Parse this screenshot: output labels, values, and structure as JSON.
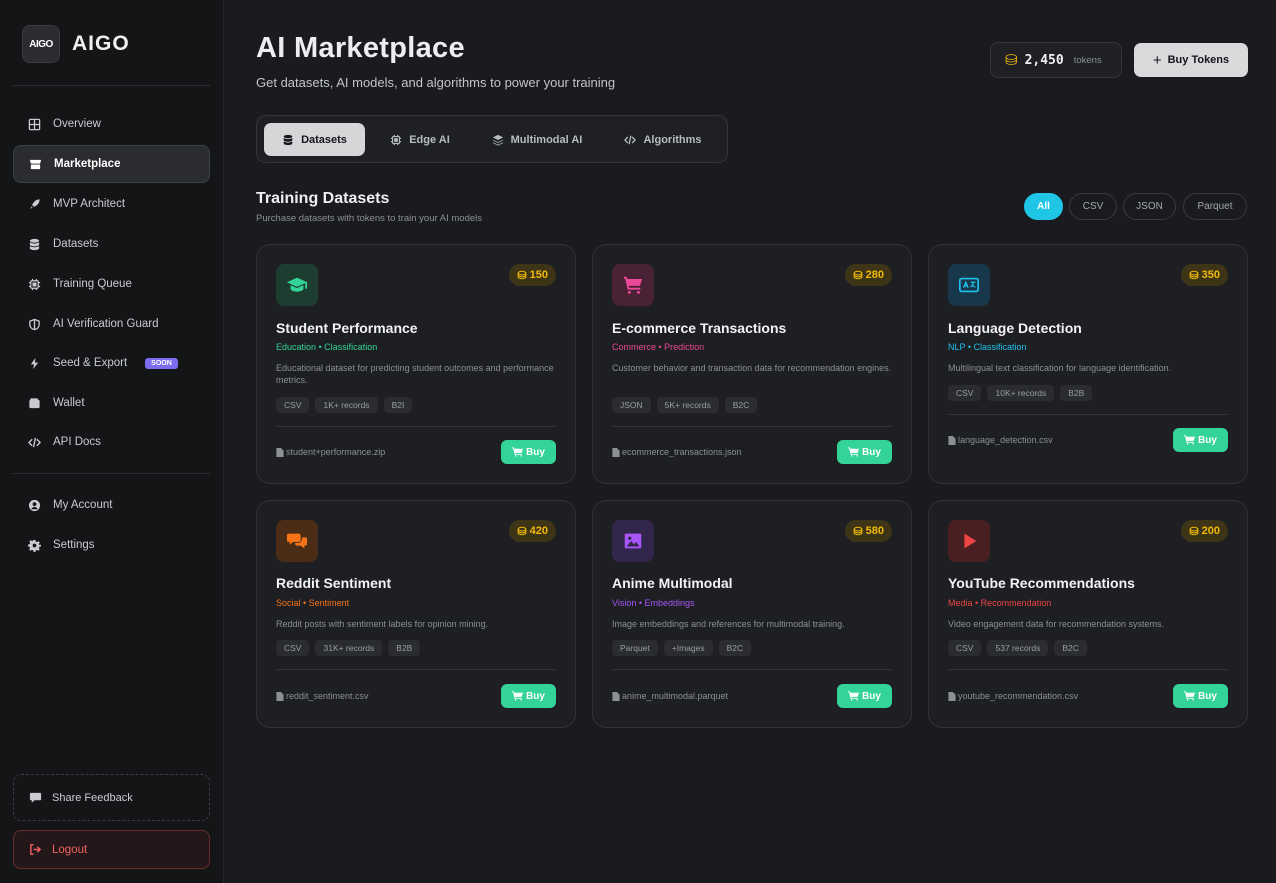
{
  "brand": {
    "name": "AIGO",
    "logo_text": "AIGO"
  },
  "sidebar": {
    "items": [
      {
        "label": "Overview",
        "icon": "grid-icon"
      },
      {
        "label": "Marketplace",
        "icon": "store-icon"
      },
      {
        "label": "MVP Architect",
        "icon": "rocket-icon"
      },
      {
        "label": "Datasets",
        "icon": "database-icon"
      },
      {
        "label": "Training Queue",
        "icon": "chip-icon"
      },
      {
        "label": "AI Verification Guard",
        "icon": "shield-icon"
      },
      {
        "label": "Seed & Export",
        "icon": "lightning-icon",
        "badge": "SOON"
      },
      {
        "label": "Wallet",
        "icon": "wallet-icon"
      },
      {
        "label": "API Docs",
        "icon": "code-icon"
      }
    ],
    "account_items": [
      {
        "label": "My Account",
        "icon": "user-icon"
      },
      {
        "label": "Settings",
        "icon": "gear-icon"
      }
    ],
    "feedback_label": "Share Feedback",
    "logout_label": "Logout"
  },
  "header": {
    "title": "AI Marketplace",
    "subtitle": "Get datasets, AI models, and algorithms to power your training",
    "tokens_value": "2,450",
    "tokens_label": "tokens",
    "buy_tokens_label": "Buy Tokens"
  },
  "tabs": [
    {
      "label": "Datasets",
      "icon": "database-icon",
      "active": true
    },
    {
      "label": "Edge AI",
      "icon": "chip-icon"
    },
    {
      "label": "Multimodal AI",
      "icon": "layers-icon"
    },
    {
      "label": "Algorithms",
      "icon": "code-icon"
    }
  ],
  "section": {
    "title": "Training Datasets",
    "subtitle": "Purchase datasets with tokens to train your AI models",
    "filters": [
      {
        "label": "All",
        "active": true
      },
      {
        "label": "CSV"
      },
      {
        "label": "JSON"
      },
      {
        "label": "Parquet"
      }
    ]
  },
  "cards": [
    {
      "title": "Student Performance",
      "tags": "Education • Classification",
      "tag_color": "#34d399",
      "icon": "graduation-cap-icon",
      "icon_bg": "#1e3d31",
      "icon_color": "#34d399",
      "price": "150",
      "desc": "Educational dataset for predicting student outcomes and performance metrics.",
      "chips": [
        "CSV",
        "1K+ records",
        "B2I"
      ],
      "file": "student+performance.zip",
      "buy": "Buy"
    },
    {
      "title": "E-commerce Transactions",
      "tags": "Commerce • Prediction",
      "tag_color": "#ec4899",
      "icon": "cart-icon",
      "icon_bg": "#4a2236",
      "icon_color": "#ec4899",
      "price": "280",
      "desc": "Customer behavior and transaction data for recommendation engines.",
      "chips": [
        "JSON",
        "5K+ records",
        "B2C"
      ],
      "file": "ecommerce_transactions.json",
      "buy": "Buy"
    },
    {
      "title": "Language Detection",
      "tags": "NLP • Classification",
      "tag_color": "#22c1ee",
      "icon": "translate-icon",
      "icon_bg": "#17384a",
      "icon_color": "#22c1ee",
      "price": "350",
      "desc": "Multilingual text classification for language identification.",
      "chips": [
        "CSV",
        "10K+ records",
        "B2B"
      ],
      "file": "language_detection.csv",
      "buy": "Buy"
    },
    {
      "title": "Reddit Sentiment",
      "tags": "Social • Sentiment",
      "tag_color": "#f97316",
      "icon": "chat-bubbles-icon",
      "icon_bg": "#4a2c17",
      "icon_color": "#f97316",
      "price": "420",
      "desc": "Reddit posts with sentiment labels for opinion mining.",
      "chips": [
        "CSV",
        "31K+ records",
        "B2B"
      ],
      "file": "reddit_sentiment.csv",
      "buy": "Buy"
    },
    {
      "title": "Anime Multimodal",
      "tags": "Vision • Embeddings",
      "tag_color": "#a855f7",
      "icon": "image-icon",
      "icon_bg": "#33264d",
      "icon_color": "#a855f7",
      "price": "580",
      "desc": "Image embeddings and references for multimodal training.",
      "chips": [
        "Parquet",
        "+Images",
        "B2C"
      ],
      "file": "anime_multimodal.parquet",
      "buy": "Buy"
    },
    {
      "title": "YouTube Recommendations",
      "tags": "Media • Recommendation",
      "tag_color": "#ef4444",
      "icon": "play-icon",
      "icon_bg": "#4a1f22",
      "icon_color": "#ef4444",
      "price": "200",
      "desc": "Video engagement data for recommendation systems.",
      "chips": [
        "CSV",
        "537 records",
        "B2C"
      ],
      "file": "youtube_recommendation.csv",
      "buy": "Buy"
    }
  ]
}
